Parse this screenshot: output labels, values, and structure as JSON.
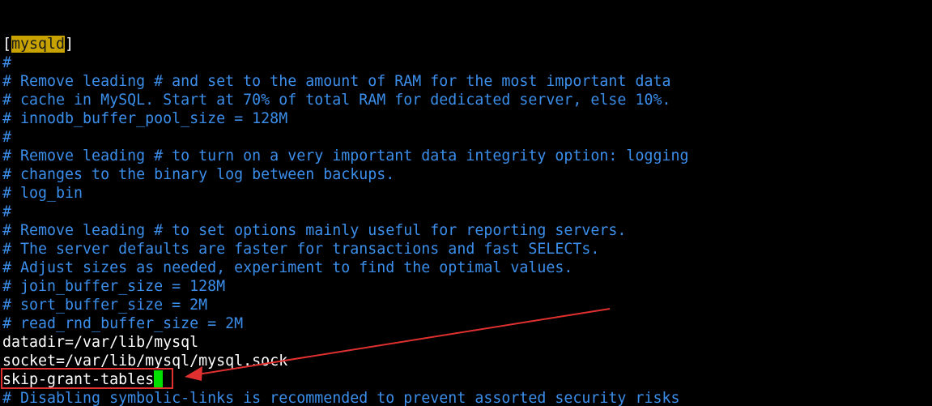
{
  "terminal": {
    "section_open": "[",
    "section_name": "mysqld",
    "section_close": "]",
    "lines": [
      "#",
      "# Remove leading # and set to the amount of RAM for the most important data",
      "# cache in MySQL. Start at 70% of total RAM for dedicated server, else 10%.",
      "# innodb_buffer_pool_size = 128M",
      "#",
      "# Remove leading # to turn on a very important data integrity option: logging",
      "# changes to the binary log between backups.",
      "# log_bin",
      "#",
      "# Remove leading # to set options mainly useful for reporting servers.",
      "# The server defaults are faster for transactions and fast SELECTs.",
      "# Adjust sizes as needed, experiment to find the optimal values.",
      "# join_buffer_size = 128M",
      "# sort_buffer_size = 2M",
      "# read_rnd_buffer_size = 2M"
    ],
    "datadir": "datadir=/var/lib/mysql",
    "socket": "socket=/var/lib/mysql/mysql.sock",
    "skip_grant": "skip-grant-tables",
    "last_comment": "# Disabling symbolic-links is recommended to prevent assorted security risks"
  },
  "colors": {
    "comment": "#3b8eea",
    "plain": "#ffffff",
    "section_highlight": "#c8a300",
    "cursor": "#00e000",
    "annotation": "#e03030"
  }
}
